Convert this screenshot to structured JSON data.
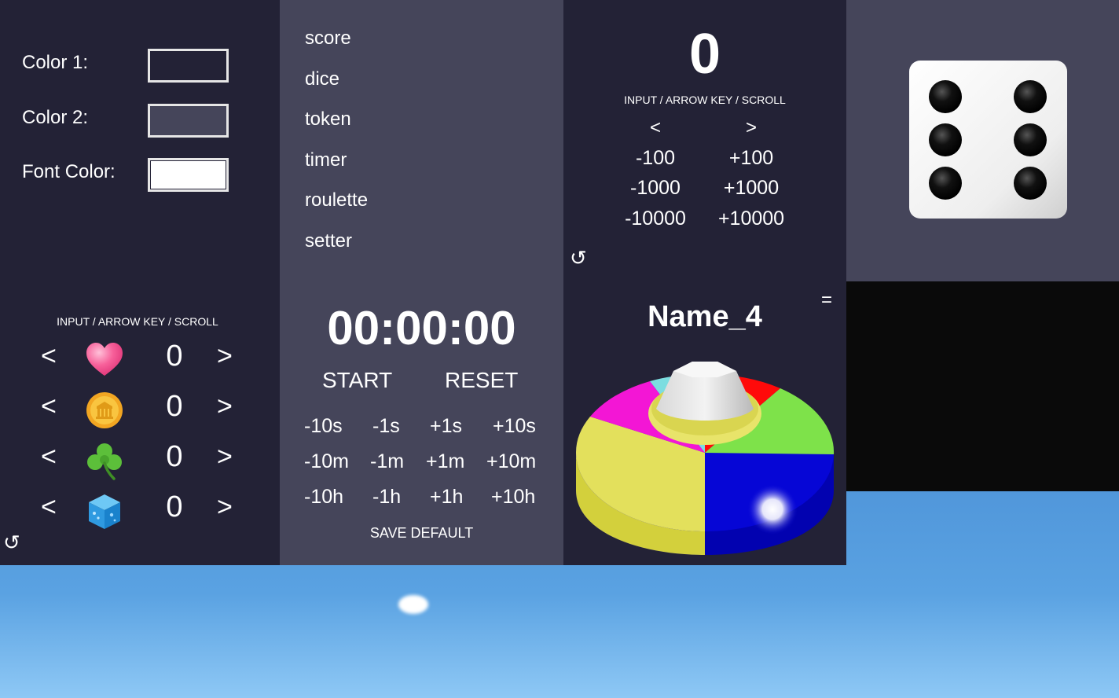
{
  "colors": {
    "color1_label": "Color 1:",
    "color2_label": "Color 2:",
    "font_color_label": "Font Color:",
    "color1_value": "#232236",
    "color2_value": "#45455a",
    "font_color_value": "#ffffff"
  },
  "tokens": {
    "hint": "INPUT / ARROW KEY / SCROLL",
    "prev": "<",
    "next": ">",
    "items": [
      {
        "icon": "heart-icon",
        "value": "0"
      },
      {
        "icon": "coin-icon",
        "value": "0"
      },
      {
        "icon": "clover-icon",
        "value": "0"
      },
      {
        "icon": "ice-cube-icon",
        "value": "0"
      }
    ],
    "reset_icon": "↺"
  },
  "menu": {
    "items": [
      "score",
      "dice",
      "token",
      "timer",
      "roulette",
      "setter"
    ]
  },
  "timer": {
    "display": "00:00:00",
    "start": "START",
    "reset": "RESET",
    "adjust": [
      [
        "-10s",
        "-1s",
        "+1s",
        "+10s"
      ],
      [
        "-10m",
        "-1m",
        "+1m",
        "+10m"
      ],
      [
        "-10h",
        "-1h",
        "+1h",
        "+10h"
      ]
    ],
    "save_default": "SAVE DEFAULT"
  },
  "score": {
    "value": "0",
    "hint": "INPUT / ARROW KEY / SCROLL",
    "prev": "<",
    "next": ">",
    "buttons": [
      [
        "-100",
        "+100"
      ],
      [
        "-1000",
        "+1000"
      ],
      [
        "-10000",
        "+10000"
      ]
    ],
    "reset_icon": "↺"
  },
  "roulette": {
    "name": "Name_4",
    "menu_icon": "=",
    "colors": [
      "#e3e05c",
      "#f316d5",
      "#7cdde0",
      "#ff0a0a",
      "#7ee24a",
      "#0606d6"
    ]
  },
  "dice": {
    "face": 6
  }
}
